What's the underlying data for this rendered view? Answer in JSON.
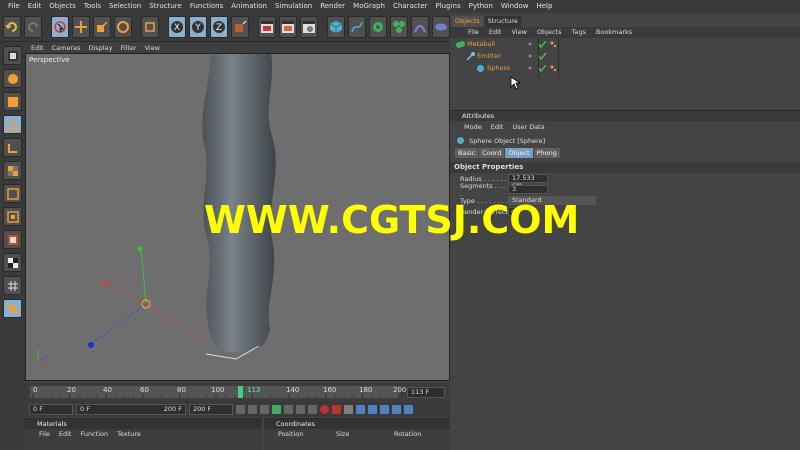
{
  "menu": [
    "File",
    "Edit",
    "Objects",
    "Tools",
    "Selection",
    "Structure",
    "Functions",
    "Animation",
    "Simulation",
    "Render",
    "MoGraph",
    "Character",
    "Plugins",
    "Python",
    "Window",
    "Help"
  ],
  "viewport": {
    "menu": [
      "Edit",
      "Cameras",
      "Display",
      "Filter",
      "View"
    ],
    "label": "Perspective"
  },
  "objects_panel": {
    "tabs": [
      "Objects",
      "Structure"
    ],
    "menu": [
      "File",
      "Edit",
      "View",
      "Objects",
      "Tags",
      "Bookmarks"
    ],
    "items": [
      "Metaball",
      "Emitter",
      "Sphere"
    ]
  },
  "attributes_panel": {
    "title": "Attributes",
    "menu": [
      "Mode",
      "Edit",
      "User Data"
    ],
    "object_title": "Sphere Object [Sphere]",
    "tabs": [
      "Basic",
      "Coord",
      "Object",
      "Phong"
    ],
    "section": "Object Properties",
    "props": [
      {
        "label": "Radius . . . . . .",
        "value": "17.533 cm"
      },
      {
        "label": "Segments . . . .",
        "value": "3"
      },
      {
        "label": "Type . . . . . . . .",
        "value": "Standard"
      },
      {
        "label": "Render Perfect",
        "value": "✓"
      }
    ]
  },
  "timeline": {
    "ticks": [
      "0",
      "20",
      "40",
      "60",
      "80",
      "100",
      "120",
      "140",
      "160",
      "180",
      "200"
    ],
    "current_frame": "113",
    "frame_field": "113 F"
  },
  "transport": {
    "start": "0 F",
    "range_start": "0 F",
    "range_end": "200 F",
    "end": "200 F"
  },
  "materials": {
    "title": "Materials",
    "menu": [
      "File",
      "Edit",
      "Function",
      "Texture"
    ]
  },
  "coordinates": {
    "title": "Coordinates",
    "columns": [
      "Position",
      "Size",
      "Rotation"
    ]
  },
  "watermark": "WWW.CGTSJ.COM",
  "colors": {
    "accent": "#f0a030",
    "selected": "#8ab0d0",
    "viewport_bg": "#6e6e6e"
  }
}
